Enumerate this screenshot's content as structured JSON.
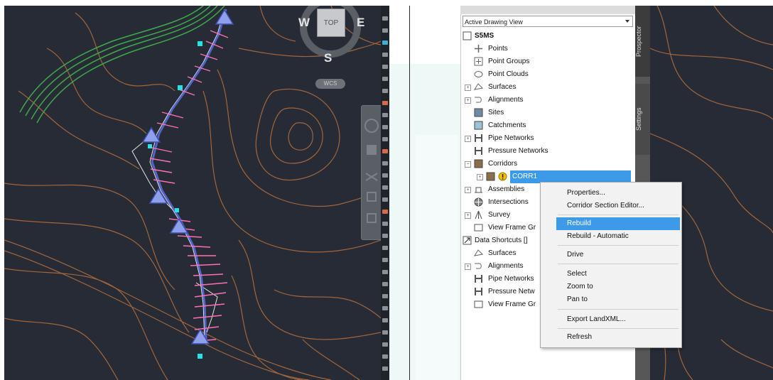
{
  "viewcube": {
    "top": "TOP",
    "west": "W",
    "east": "E",
    "south": "S",
    "wcs": "WCS"
  },
  "prospector": {
    "view_selector": "Active Drawing View",
    "tabs": [
      "Prospector",
      "Settings"
    ],
    "drawing": "S5MS",
    "tree": {
      "points": "Points",
      "point_groups": "Point Groups",
      "point_clouds": "Point Clouds",
      "surfaces": "Surfaces",
      "alignments": "Alignments",
      "sites": "Sites",
      "catchments": "Catchments",
      "pipe_networks": "Pipe Networks",
      "pressure_networks": "Pressure Networks",
      "corridors": "Corridors",
      "corr1": "CORR1",
      "assemblies": "Assemblies",
      "intersections": "Intersections",
      "survey": "Survey",
      "view_frame_groups": "View Frame Gr",
      "data_shortcuts": "Data Shortcuts []",
      "ds_surfaces": "Surfaces",
      "ds_alignments": "Alignments",
      "ds_pipe_networks": "Pipe Networks",
      "ds_pressure_networks": "Pressure Netw",
      "ds_view_frame_groups": "View Frame Gr"
    }
  },
  "context_menu": {
    "properties": "Properties...",
    "corridor_section_editor": "Corridor Section Editor...",
    "rebuild": "Rebuild",
    "rebuild_automatic": "Rebuild - Automatic",
    "drive": "Drive",
    "select": "Select",
    "zoom_to": "Zoom to",
    "pan_to": "Pan to",
    "export_landxml": "Export LandXML...",
    "refresh": "Refresh"
  },
  "colors": {
    "viewport_bg": "#262b35",
    "contour": "#b8703d",
    "highlight": "#3d9ae8",
    "polygon_green": "#3fa84c"
  }
}
